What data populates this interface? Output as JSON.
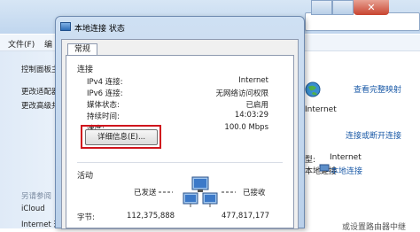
{
  "background": {
    "menu": {
      "file": "文件(F)",
      "edit": "编"
    },
    "left": {
      "items": [
        "控制面板主",
        "更改适配器",
        "更改高级共"
      ],
      "see_also": "另请参阅",
      "links": [
        "iCloud",
        "Internet 选"
      ]
    },
    "right": {
      "view_full_map": "查看完整映射",
      "internet": "Internet",
      "connect_or_disconnect": "连接或断开连接",
      "access_type_label": "型:",
      "access_type_value": "Internet",
      "connection_label": "本地连接",
      "bottom_text": "或设置路由器中继",
      "close_glyph": "✕"
    }
  },
  "dialog": {
    "title": "本地连接 状态",
    "tab": "常规",
    "connection_section": "连接",
    "rows": [
      {
        "label": "IPv4 连接:",
        "value": "Internet"
      },
      {
        "label": "IPv6 连接:",
        "value": "无网络访问权限"
      },
      {
        "label": "媒体状态:",
        "value": "已启用"
      },
      {
        "label": "持续时间:",
        "value": "14:03:29"
      },
      {
        "label": "速度:",
        "value": "100.0 Mbps"
      }
    ],
    "details_button": "详细信息(E)...",
    "activity_section": "活动",
    "sent_label": "已发送",
    "received_label": "已接收",
    "bytes_label": "字节:",
    "bytes_sent": "112,375,888",
    "bytes_received": "477,817,177"
  },
  "colors": {
    "highlight": "#d0151d",
    "link": "#1c5ba8"
  }
}
